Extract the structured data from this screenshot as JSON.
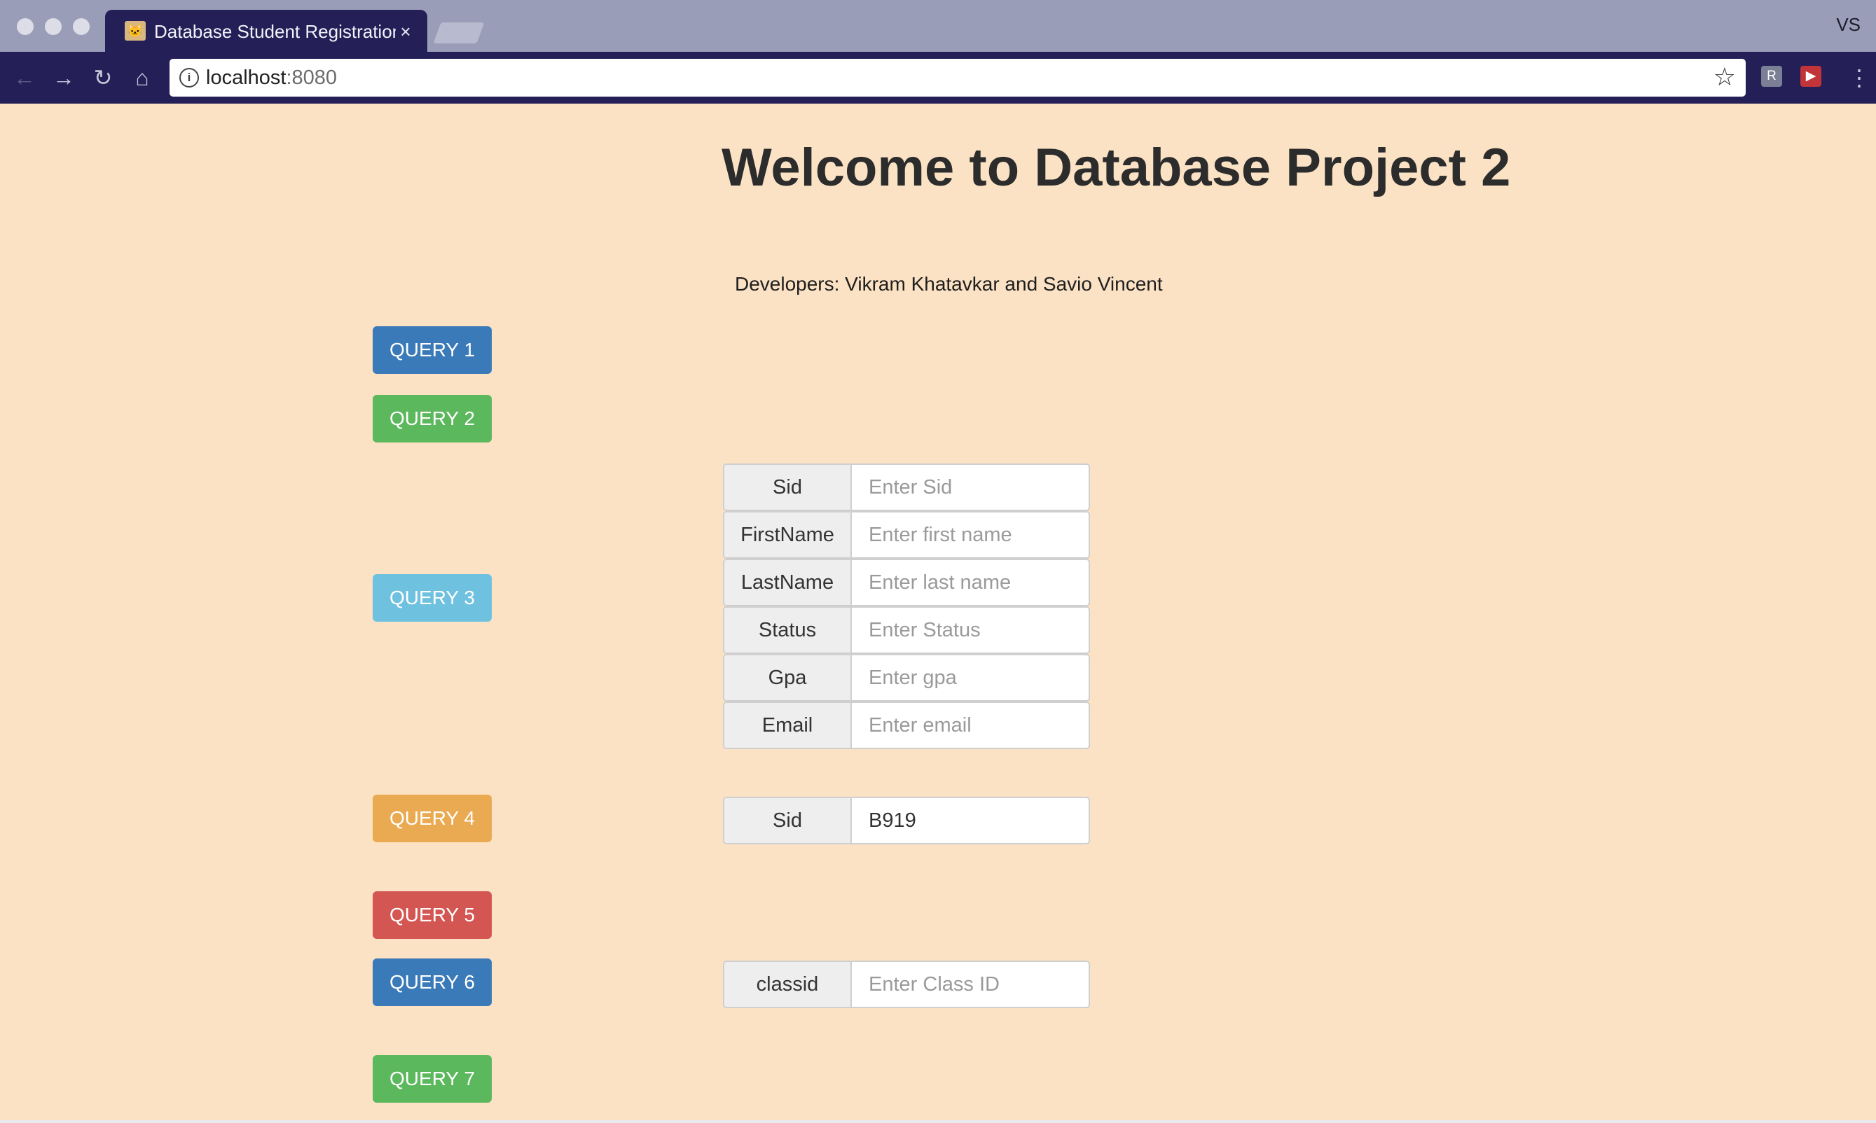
{
  "browser": {
    "tab_title": "Database Student Registration",
    "tab_close": "×",
    "profile": "VS",
    "url_host": "localhost",
    "url_port": ":8080"
  },
  "page": {
    "title": "Welcome to Database Project 2",
    "developers": "Developers: Vikram Khatavkar and Savio Vincent"
  },
  "queries": {
    "q1": "QUERY 1",
    "q2": "QUERY 2",
    "q3": "QUERY 3",
    "q4": "QUERY 4",
    "q5": "QUERY 5",
    "q6": "QUERY 6",
    "q7": "QUERY 7"
  },
  "query3_form": {
    "sid_label": "Sid",
    "sid_placeholder": "Enter Sid",
    "firstname_label": "FirstName",
    "firstname_placeholder": "Enter first name",
    "lastname_label": "LastName",
    "lastname_placeholder": "Enter last name",
    "status_label": "Status",
    "status_placeholder": "Enter Status",
    "gpa_label": "Gpa",
    "gpa_placeholder": "Enter gpa",
    "email_label": "Email",
    "email_placeholder": "Enter email"
  },
  "query4_form": {
    "sid_label": "Sid",
    "sid_value": "B919"
  },
  "query6_form": {
    "classid_label": "classid",
    "classid_placeholder": "Enter Class ID"
  },
  "colors": {
    "page_background": "#fbe2c4",
    "primary": "#3a7ab8",
    "success": "#5cb85c",
    "info": "#6fc1e0",
    "warning": "#eaaa52",
    "danger": "#d45653"
  }
}
